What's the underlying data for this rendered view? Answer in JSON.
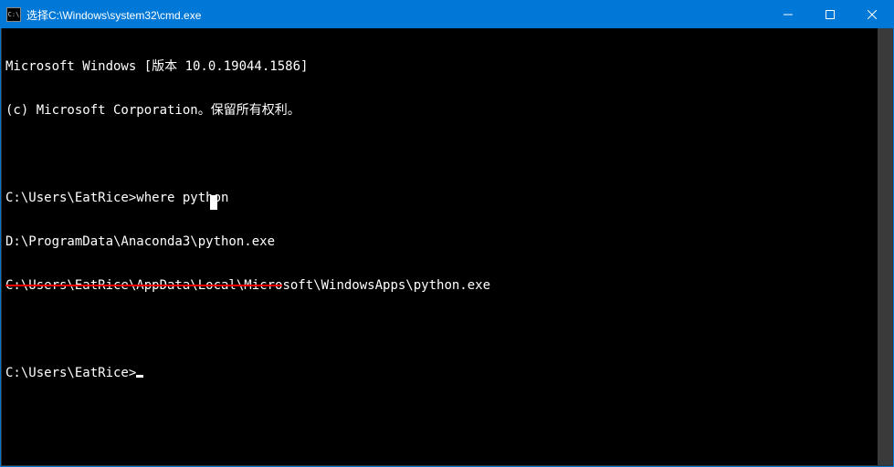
{
  "titlebar": {
    "icon_label": "C:\\",
    "title": "选择C:\\Windows\\system32\\cmd.exe"
  },
  "window_controls": {
    "minimize": "minimize",
    "maximize": "maximize",
    "close": "close"
  },
  "terminal": {
    "lines": [
      "Microsoft Windows [版本 10.0.19044.1586]",
      "(c) Microsoft Corporation。保留所有权利。",
      "",
      "C:\\Users\\EatRice>where python",
      "D:\\ProgramData\\Anaconda3\\python.exe"
    ],
    "struck_part": "C:\\Users\\EatRice\\AppData\\Local\\Micro",
    "struck_rest": "soft\\WindowsApps\\python.exe",
    "prompt": "C:\\Users\\EatRice>"
  },
  "colors": {
    "titlebar_bg": "#0078d7",
    "terminal_bg": "#000000",
    "terminal_fg": "#ffffff",
    "strike_color": "#ff0000"
  }
}
